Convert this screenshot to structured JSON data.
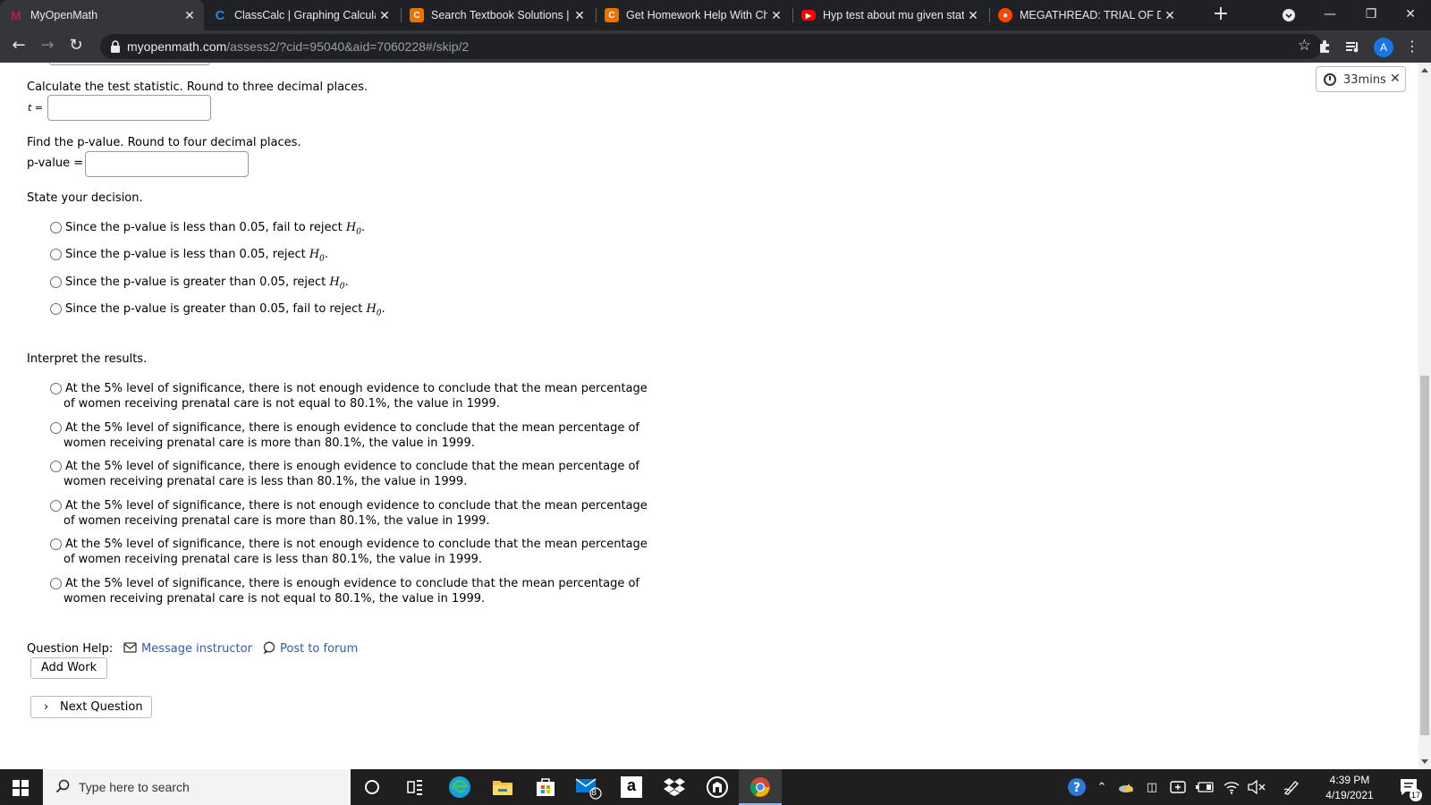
{
  "browser": {
    "tabs": [
      {
        "title": "MyOpenMath",
        "icon": "myopenmath-icon",
        "color": "#c2185b",
        "glyph": "M",
        "active": true
      },
      {
        "title": "ClassCalc | Graphing Calculato",
        "icon": "classcalc-icon",
        "color": "#1e88e5",
        "glyph": "C"
      },
      {
        "title": "Search Textbook Solutions | C",
        "icon": "chegg-icon",
        "color": "#eb7100",
        "glyph": "C"
      },
      {
        "title": "Get Homework Help With Che",
        "icon": "chegg-icon",
        "color": "#eb7100",
        "glyph": "C"
      },
      {
        "title": "Hyp test about mu given stats",
        "icon": "youtube-icon",
        "color": "#ff0000",
        "glyph": "▶"
      },
      {
        "title": "MEGATHREAD: TRIAL OF DER",
        "icon": "reddit-icon",
        "color": "#ff4500",
        "glyph": "●"
      }
    ],
    "url_host": "myopenmath.com",
    "url_path": "/assess2/?cid=95040&aid=7060228#/skip/2"
  },
  "timer": {
    "label": "33mins"
  },
  "questions": {
    "test_stat_prompt": "Calculate the test statistic. Round to three decimal places.",
    "t_label": "t =",
    "pvalue_prompt": "Find the p-value. Round to four decimal places.",
    "pvalue_label": "p-value =",
    "decision_prompt": "State your decision.",
    "decision_options": [
      {
        "text": "Since the p-value is less than 0.05, fail to reject ",
        "h": "H",
        "sub": "0",
        "end": "."
      },
      {
        "text": "Since the p-value is less than 0.05, reject ",
        "h": "H",
        "sub": "0",
        "end": "."
      },
      {
        "text": "Since the p-value is greater than 0.05, reject ",
        "h": "H",
        "sub": "0",
        "end": "."
      },
      {
        "text": "Since the p-value is greater than 0.05, fail to reject ",
        "h": "H",
        "sub": "0",
        "end": "."
      }
    ],
    "interpret_prompt": "Interpret the results.",
    "interpret_options": [
      {
        "line1": "At the 5% level of significance, there is not enough evidence to conclude that the mean percentage",
        "line2": "of women receiving prenatal care is not equal to 80.1%, the value in 1999."
      },
      {
        "line1": "At the 5% level of significance, there is enough evidence to conclude that the mean percentage of",
        "line2": "women receiving prenatal care is more than 80.1%, the value in 1999."
      },
      {
        "line1": "At the 5% level of significance, there is enough evidence to conclude that the mean percentage of",
        "line2": "women receiving prenatal care is less than 80.1%, the value in 1999."
      },
      {
        "line1": "At the 5% level of significance, there is not enough evidence to conclude that the mean percentage",
        "line2": "of women receiving prenatal care is more than 80.1%, the value in 1999."
      },
      {
        "line1": "At the 5% level of significance, there is not enough evidence to conclude that the mean percentage",
        "line2": "of women receiving prenatal care is less than 80.1%, the value in 1999."
      },
      {
        "line1": "At the 5% level of significance, there is enough evidence to conclude that the mean percentage of",
        "line2": "women receiving prenatal care is not equal to 80.1%, the value in 1999."
      }
    ]
  },
  "help": {
    "label": "Question Help:",
    "message": "Message instructor",
    "forum": "Post to forum",
    "add_work": "Add Work",
    "next": "Next Question"
  },
  "taskbar": {
    "search_placeholder": "Type here to search",
    "mail_badge": "8",
    "time": "4:39 PM",
    "date": "4/19/2021",
    "notifications": "17"
  }
}
